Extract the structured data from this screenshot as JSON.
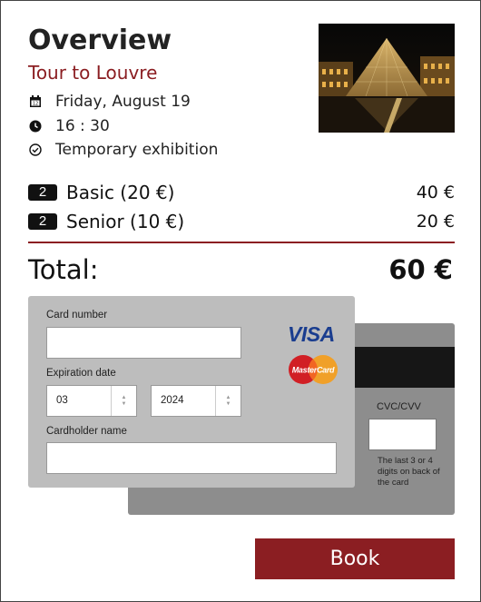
{
  "header": {
    "title": "Overview",
    "subtitle": "Tour to Louvre"
  },
  "event": {
    "date": "Friday, August 19",
    "time": "16 : 30",
    "exhibition": "Temporary exhibition",
    "date_icon": "calendar-icon",
    "time_icon": "clock-icon",
    "exhibition_icon": "check-circle-icon"
  },
  "tickets": [
    {
      "qty": "2",
      "name": "Basic (20 €)",
      "price": "40 €"
    },
    {
      "qty": "2",
      "name": "Senior (10 €)",
      "price": "20 €"
    }
  ],
  "total": {
    "label": "Total:",
    "value": "60 €"
  },
  "payment": {
    "card_number_label": "Card number",
    "card_number_value": "",
    "expiration_label": "Expiration date",
    "exp_month": "03",
    "exp_year": "2024",
    "cardholder_label": "Cardholder name",
    "cardholder_value": "",
    "cvc_label": "CVC/CVV",
    "cvc_value": "",
    "cvc_hint": "The last 3 or 4 digits on back of the card",
    "brands": [
      "VISA",
      "MasterCard"
    ]
  },
  "actions": {
    "book_label": "Book"
  },
  "colors": {
    "accent": "#8b1e22",
    "card_front": "#bdbdbd",
    "card_back": "#8d8d8d"
  }
}
